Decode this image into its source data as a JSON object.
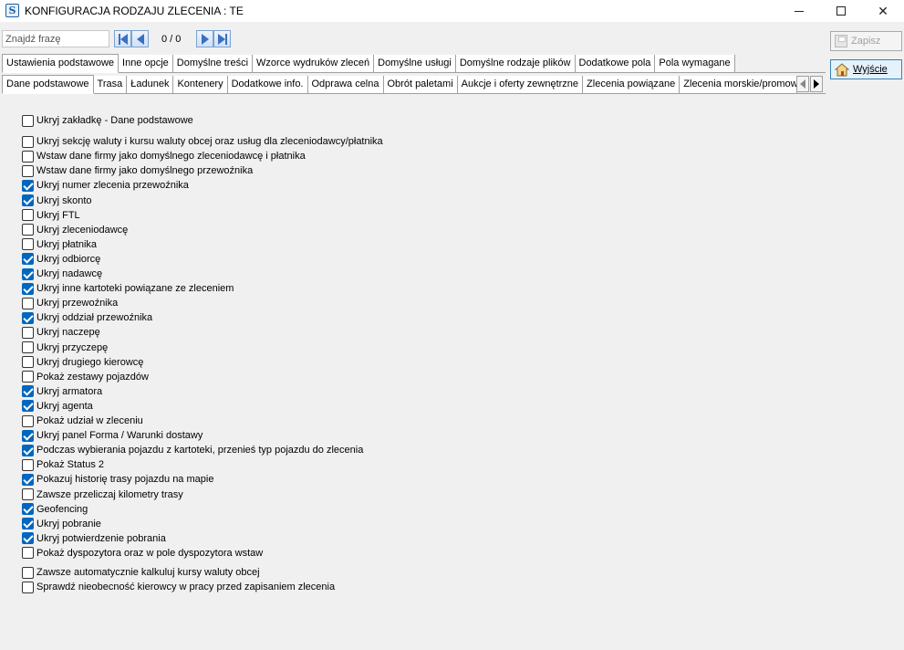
{
  "window": {
    "title": "KONFIGURACJA RODZAJU ZLECENIA : TE",
    "app_icon": "S"
  },
  "search": {
    "placeholder": "Znajdź frazę",
    "value": "",
    "counter": "0 / 0"
  },
  "actions": {
    "save_label": "Zapisz",
    "exit_label": "Wyjście"
  },
  "main_tabs": [
    {
      "label": "Ustawienia podstawowe",
      "active": true
    },
    {
      "label": "Inne opcje",
      "active": false
    },
    {
      "label": "Domyślne treści",
      "active": false
    },
    {
      "label": "Wzorce wydruków zleceń",
      "active": false
    },
    {
      "label": "Domyślne usługi",
      "active": false
    },
    {
      "label": "Domyślne rodzaje plików",
      "active": false
    },
    {
      "label": "Dodatkowe pola",
      "active": false
    },
    {
      "label": "Pola wymagane",
      "active": false
    }
  ],
  "sub_tabs": [
    {
      "label": "Dane podstawowe",
      "active": true
    },
    {
      "label": "Trasa",
      "active": false
    },
    {
      "label": "Ładunek",
      "active": false
    },
    {
      "label": "Kontenery",
      "active": false
    },
    {
      "label": "Dodatkowe info.",
      "active": false
    },
    {
      "label": "Odprawa celna",
      "active": false
    },
    {
      "label": "Obrót paletami",
      "active": false
    },
    {
      "label": "Aukcje i oferty zewnętrzne",
      "active": false
    },
    {
      "label": "Zlecenia powiązane",
      "active": false
    },
    {
      "label": "Zlecenia morskie/promow",
      "active": false
    }
  ],
  "options": [
    {
      "label": "Ukryj zakładkę - Dane podstawowe",
      "checked": false
    },
    {
      "label": "Ukryj sekcję waluty i kursu waluty obcej oraz usług dla zleceniodawcy/płatnika",
      "checked": false
    },
    {
      "label": "Wstaw dane firmy jako domyślnego zleceniodawcę i płatnika",
      "checked": false
    },
    {
      "label": "Wstaw dane firmy jako domyślnego przewoźnika",
      "checked": false
    },
    {
      "label": "Ukryj numer zlecenia przewoźnika",
      "checked": true
    },
    {
      "label": "Ukryj skonto",
      "checked": true
    },
    {
      "label": "Ukryj FTL",
      "checked": false
    },
    {
      "label": "Ukryj zleceniodawcę",
      "checked": false
    },
    {
      "label": "Ukryj płatnika",
      "checked": false
    },
    {
      "label": "Ukryj odbiorcę",
      "checked": true
    },
    {
      "label": "Ukryj nadawcę",
      "checked": true
    },
    {
      "label": "Ukryj inne kartoteki powiązane ze zleceniem",
      "checked": true
    },
    {
      "label": "Ukryj przewoźnika",
      "checked": false
    },
    {
      "label": "Ukryj oddział przewoźnika",
      "checked": true
    },
    {
      "label": "Ukryj naczepę",
      "checked": false
    },
    {
      "label": "Ukryj przyczepę",
      "checked": false
    },
    {
      "label": "Ukryj drugiego kierowcę",
      "checked": false
    },
    {
      "label": "Pokaż zestawy pojazdów",
      "checked": false
    },
    {
      "label": "Ukryj armatora",
      "checked": true
    },
    {
      "label": "Ukryj agenta",
      "checked": true
    },
    {
      "label": "Pokaż udział w zleceniu",
      "checked": false
    },
    {
      "label": "Ukryj panel Forma / Warunki dostawy",
      "checked": true
    },
    {
      "label": "Podczas wybierania pojazdu z kartoteki, przenieś typ pojazdu do zlecenia",
      "checked": true
    },
    {
      "label": "Pokaż Status 2",
      "checked": false
    },
    {
      "label": "Pokazuj historię trasy pojazdu na mapie",
      "checked": true
    },
    {
      "label": "Zawsze przeliczaj kilometry trasy",
      "checked": false
    },
    {
      "label": "Geofencing",
      "checked": true
    },
    {
      "label": "Ukryj pobranie",
      "checked": true
    },
    {
      "label": "Ukryj potwierdzenie pobrania",
      "checked": true
    },
    {
      "label": "Pokaż dyspozytora oraz w pole dyspozytora wstaw",
      "checked": false
    },
    {
      "label": "Zawsze automatycznie kalkuluj kursy waluty obcej",
      "checked": false
    },
    {
      "label": "Sprawdź nieobecność kierowcy w pracy przed zapisaniem zlecenia",
      "checked": false
    }
  ]
}
